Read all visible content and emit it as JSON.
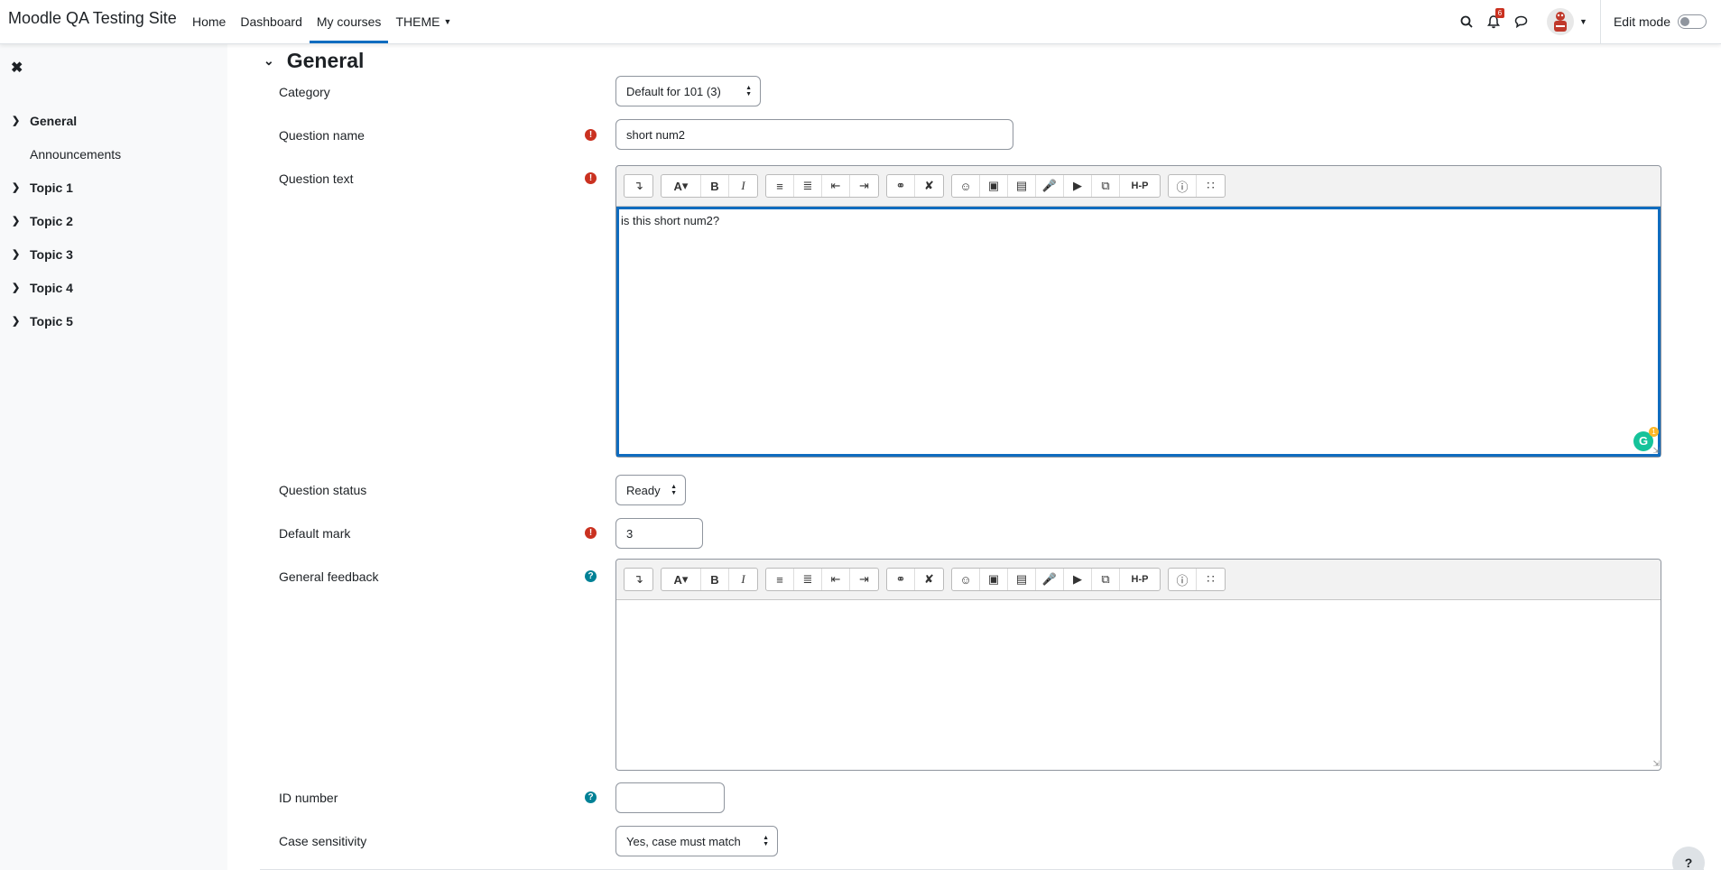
{
  "site_name": "Moodle QA Testing Site",
  "nav": {
    "items": [
      "Home",
      "Dashboard",
      "My courses",
      "THEME"
    ],
    "notification_count": "6",
    "edit_mode_label": "Edit mode"
  },
  "drawer": {
    "items": [
      {
        "label": "General",
        "type": "section"
      },
      {
        "label": "Announcements",
        "type": "sub"
      },
      {
        "label": "Topic 1",
        "type": "section"
      },
      {
        "label": "Topic 2",
        "type": "section"
      },
      {
        "label": "Topic 3",
        "type": "section"
      },
      {
        "label": "Topic 4",
        "type": "section"
      },
      {
        "label": "Topic 5",
        "type": "section"
      }
    ]
  },
  "form": {
    "section_title": "General",
    "category": {
      "label": "Category",
      "value": "Default for 101 (3)"
    },
    "question_name": {
      "label": "Question name",
      "value": "short num2"
    },
    "question_text": {
      "label": "Question text",
      "value": "is this short num2?"
    },
    "question_status": {
      "label": "Question status",
      "value": "Ready"
    },
    "default_mark": {
      "label": "Default mark",
      "value": "3"
    },
    "general_feedback": {
      "label": "General feedback",
      "value": ""
    },
    "id_number": {
      "label": "ID number",
      "value": ""
    },
    "case_sensitivity": {
      "label": "Case sensitivity",
      "value": "Yes, case must match"
    }
  },
  "grammarly_count": "1",
  "colors": {
    "accent": "#0f6cbf",
    "required": "#ca3120",
    "help": "#008196"
  }
}
